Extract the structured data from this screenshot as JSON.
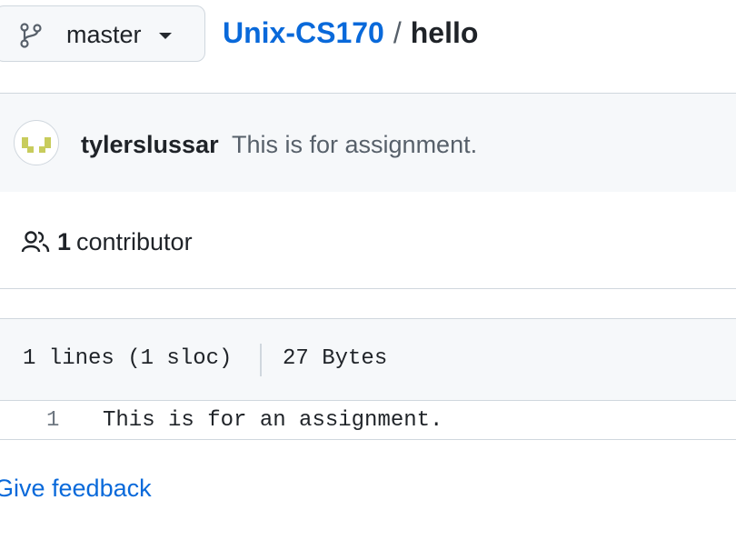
{
  "branch": {
    "name": "master",
    "icon": "git-branch-icon"
  },
  "breadcrumb": {
    "repo": "Unix-CS170",
    "separator": "/",
    "file": "hello"
  },
  "commit": {
    "author": "tylerslussar",
    "message": "This is for assignment."
  },
  "contributors": {
    "count": "1",
    "label": "contributor",
    "icon": "people-icon"
  },
  "file": {
    "lines_info": "1 lines (1 sloc)",
    "size": "27 Bytes",
    "code_lines": [
      {
        "number": "1",
        "text": "This is for an assignment."
      }
    ]
  },
  "feedback": {
    "label": "Give feedback"
  },
  "colors": {
    "link": "#0969da",
    "border": "#d0d7de",
    "header_bg": "#f6f8fa",
    "avatar_pixel": "#c8cc5c"
  }
}
